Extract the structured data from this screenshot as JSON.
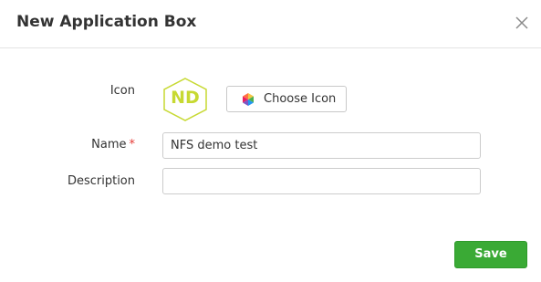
{
  "dialog": {
    "title": "New Application Box"
  },
  "form": {
    "icon_label": "Icon",
    "icon_initials": "ND",
    "choose_icon_label": "Choose Icon",
    "name_label": "Name",
    "name_required_marker": "*",
    "name_value": "NFS demo test",
    "description_label": "Description",
    "description_value": ""
  },
  "footer": {
    "save_label": "Save"
  },
  "colors": {
    "accent": "#3aaa35",
    "icon_color": "#c7d932",
    "required": "#e53935"
  }
}
